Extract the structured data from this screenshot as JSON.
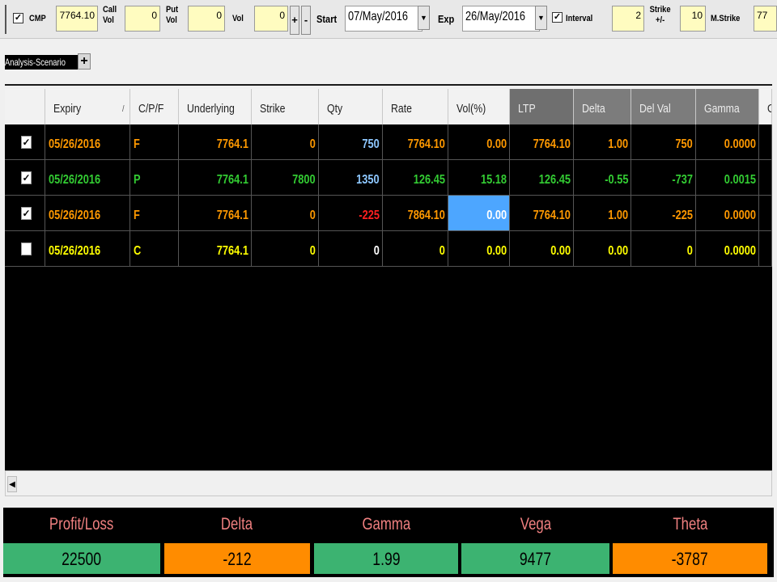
{
  "toolbar": {
    "cmp_label": "CMP",
    "cmp_value": "7764.10",
    "call_vol_label": "Call Vol",
    "call_vol_value": "0",
    "put_vol_label": "Put Vol",
    "put_vol_value": "0",
    "vol_label": "Vol",
    "vol_value": "0",
    "plus": "+",
    "minus": "-",
    "start_label": "Start",
    "start_value": "07/May/2016",
    "exp_label": "Exp",
    "exp_value": "26/May/2016",
    "interval_label": "Interval",
    "interval_value": "2",
    "strike_pm_label": "Strike +/-",
    "strike_pm_value": "10",
    "mstrike_label": "M.Strike",
    "mstrike_value": "77",
    "check_glyph": "✓",
    "dropdown_glyph": "▼"
  },
  "tabs": {
    "active": "Analysis-Scenario",
    "add": "+"
  },
  "grid": {
    "headers": [
      "",
      "Expiry",
      "C/P/F",
      "Underlying",
      "Strike",
      "Qty",
      "Rate",
      "Vol(%)",
      "LTP",
      "Delta",
      "Del Val",
      "Gamma",
      "G"
    ],
    "sort_indicator": "/",
    "rows": [
      {
        "checked": true,
        "expiry": "05/26/2016",
        "cpf": "F",
        "underlying": "7764.1",
        "strike": "0",
        "qty": "750",
        "rate": "7764.10",
        "vol": "0.00",
        "ltp": "7764.10",
        "delta": "1.00",
        "delval": "750",
        "gamma": "0.0000"
      },
      {
        "checked": true,
        "expiry": "05/26/2016",
        "cpf": "P",
        "underlying": "7764.1",
        "strike": "7800",
        "qty": "1350",
        "rate": "126.45",
        "vol": "15.18",
        "ltp": "126.45",
        "delta": "-0.55",
        "delval": "-737",
        "gamma": "0.0015"
      },
      {
        "checked": true,
        "expiry": "05/26/2016",
        "cpf": "F",
        "underlying": "7764.1",
        "strike": "0",
        "qty": "-225",
        "rate": "7864.10",
        "vol": "0.00",
        "ltp": "7764.10",
        "delta": "1.00",
        "delval": "-225",
        "gamma": "0.0000"
      },
      {
        "checked": false,
        "expiry": "05/26/2016",
        "cpf": "C",
        "underlying": "7764.1",
        "strike": "0",
        "qty": "0",
        "rate": "0",
        "vol": "0.00",
        "ltp": "0.00",
        "delta": "0.00",
        "delval": "0",
        "gamma": "0.0000"
      }
    ]
  },
  "scrollbar": {
    "left_arrow": "◀"
  },
  "summary": [
    {
      "label": "Profit/Loss",
      "value": "22500",
      "color": "#3cb371"
    },
    {
      "label": "Delta",
      "value": "-212",
      "color": "#ff8c00"
    },
    {
      "label": "Gamma",
      "value": "1.99",
      "color": "#3cb371"
    },
    {
      "label": "Vega",
      "value": "9477",
      "color": "#3cb371"
    },
    {
      "label": "Theta",
      "value": "-3787",
      "color": "#ff8c00"
    }
  ],
  "colors": {
    "row_orange": "#ff9900",
    "row_green": "#33cc33",
    "row_yellow": "#ffff00",
    "qty_blue": "#8ec8ff",
    "qty_red": "#ff2020",
    "qty_white": "#ffffff",
    "selected_cell": "#4da6ff"
  }
}
